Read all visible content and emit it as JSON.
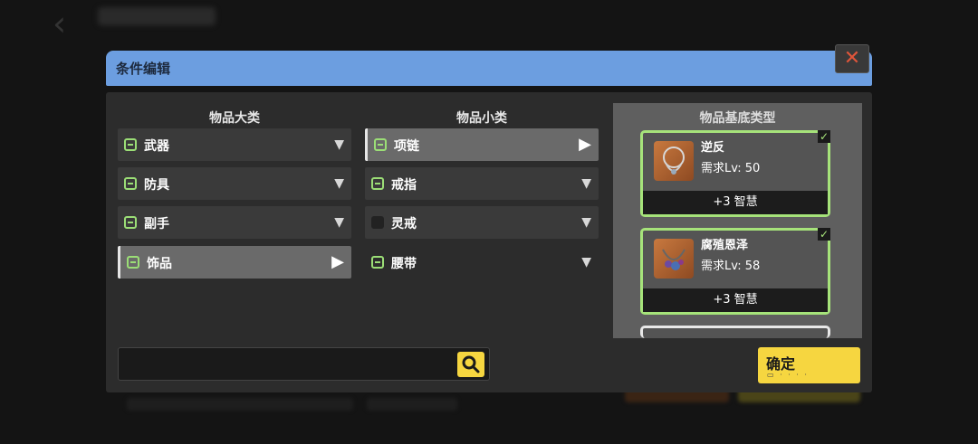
{
  "dialog": {
    "title": "条件编辑",
    "close_icon": "close-icon"
  },
  "columns": {
    "major": "物品大类",
    "minor": "物品小类",
    "base": "物品基底类型"
  },
  "major_items": [
    {
      "label": "武器",
      "checked": true,
      "active": false
    },
    {
      "label": "防具",
      "checked": true,
      "active": false
    },
    {
      "label": "副手",
      "checked": true,
      "active": false
    },
    {
      "label": "饰品",
      "checked": true,
      "active": true
    }
  ],
  "minor_items": [
    {
      "label": "项链",
      "checked": true,
      "active": true
    },
    {
      "label": "戒指",
      "checked": true,
      "active": false
    },
    {
      "label": "灵戒",
      "checked": false,
      "active": false
    },
    {
      "label": "腰带",
      "checked": true,
      "active": false
    }
  ],
  "base_items": [
    {
      "name": "逆反",
      "req": "需求Lv: 50",
      "stat": "+3 智慧"
    },
    {
      "name": "腐殖恩泽",
      "req": "需求Lv: 58",
      "stat": "+3 智慧"
    }
  ],
  "search": {
    "placeholder": ""
  },
  "confirm": {
    "label": "确定"
  },
  "colors": {
    "accent_green": "#a6e37a",
    "header_blue": "#6c9ee0",
    "button_yellow": "#f6d640"
  }
}
